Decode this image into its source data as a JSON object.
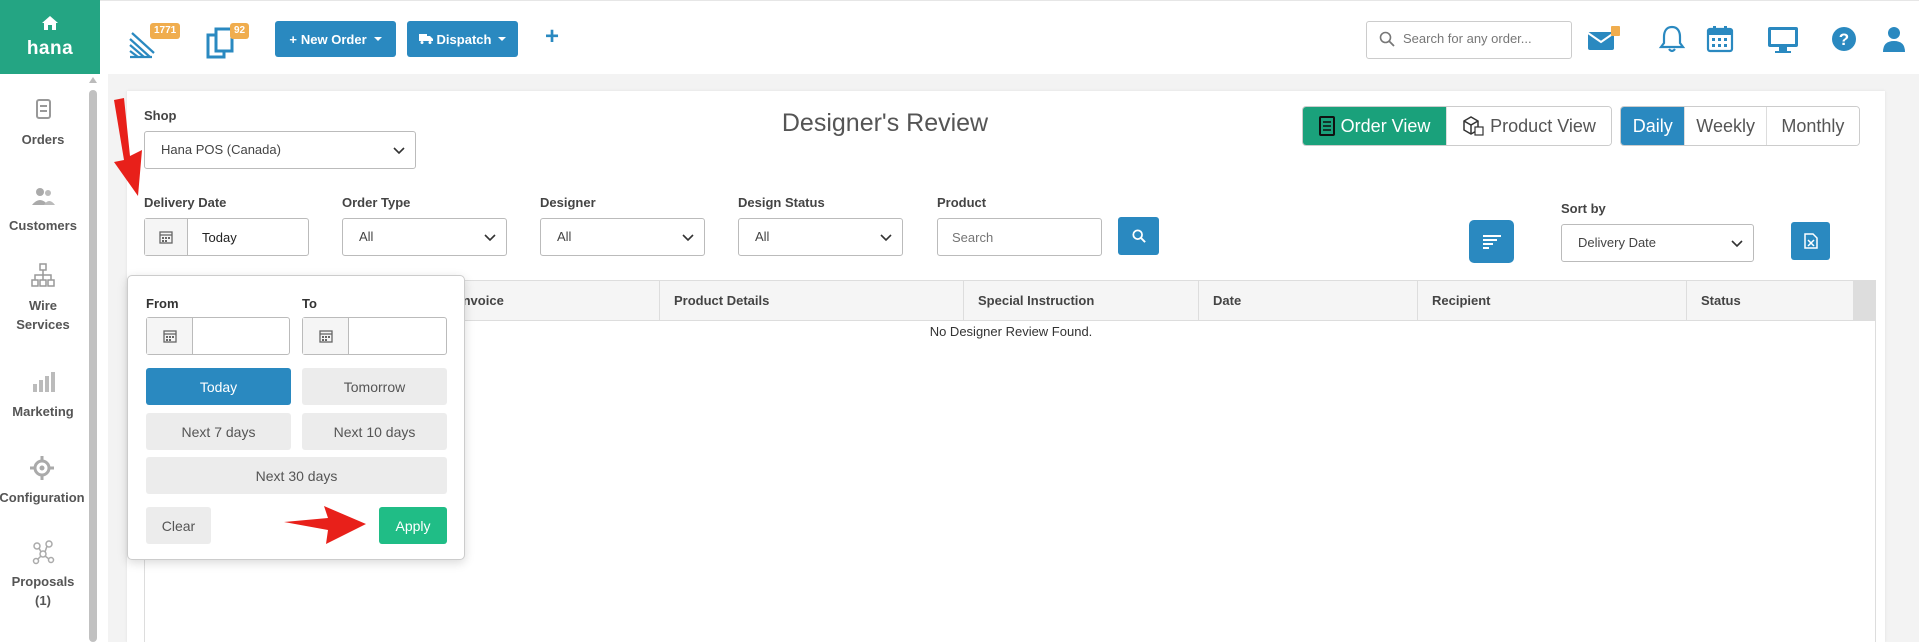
{
  "brand": {
    "name": "hana"
  },
  "sidebar": {
    "items": [
      {
        "label": "Orders",
        "icon": "orders-icon"
      },
      {
        "label": "Customers",
        "icon": "customers-icon"
      },
      {
        "label": "Wire Services",
        "line1": "Wire",
        "line2": "Services",
        "icon": "wire-services-icon"
      },
      {
        "label": "Marketing",
        "icon": "marketing-icon"
      },
      {
        "label": "Configuration",
        "icon": "configuration-icon"
      },
      {
        "label": "Proposals (1)",
        "line1": "Proposals",
        "line2": "(1)",
        "icon": "proposals-icon"
      }
    ]
  },
  "topbar": {
    "orders_badge": "1771",
    "deliveries_badge": "92",
    "new_order_label": "New Order",
    "dispatch_label": "Dispatch",
    "search_placeholder": "Search for any order..."
  },
  "page": {
    "title": "Designer's Review",
    "view_toggle": {
      "order_view": "Order View",
      "product_view": "Product View"
    },
    "period_toggle": {
      "daily": "Daily",
      "weekly": "Weekly",
      "monthly": "Monthly"
    }
  },
  "filters": {
    "shop_label": "Shop",
    "shop_value": "Hana POS (Canada)",
    "delivery_date_label": "Delivery Date",
    "delivery_date_value": "Today",
    "order_type_label": "Order Type",
    "order_type_value": "All",
    "designer_label": "Designer",
    "designer_value": "All",
    "design_status_label": "Design Status",
    "design_status_value": "All",
    "product_label": "Product",
    "product_placeholder": "Search",
    "sort_by_label": "Sort by",
    "sort_by_value": "Delivery Date"
  },
  "table": {
    "columns": [
      "Invoice",
      "Product Details",
      "Special Instruction",
      "Date",
      "Recipient",
      "Status"
    ],
    "empty_message": "No Designer Review Found."
  },
  "date_popup": {
    "from_label": "From",
    "to_label": "To",
    "from_value": "",
    "to_value": "",
    "today": "Today",
    "tomorrow": "Tomorrow",
    "next7": "Next 7 days",
    "next10": "Next 10 days",
    "next30": "Next 30 days",
    "clear": "Clear",
    "apply": "Apply"
  },
  "colors": {
    "brand_green": "#24a583",
    "primary_blue": "#2a89c0",
    "apply_green": "#20bd86",
    "badge_orange": "#f0ad4e",
    "annotation_red": "#e8201a"
  }
}
